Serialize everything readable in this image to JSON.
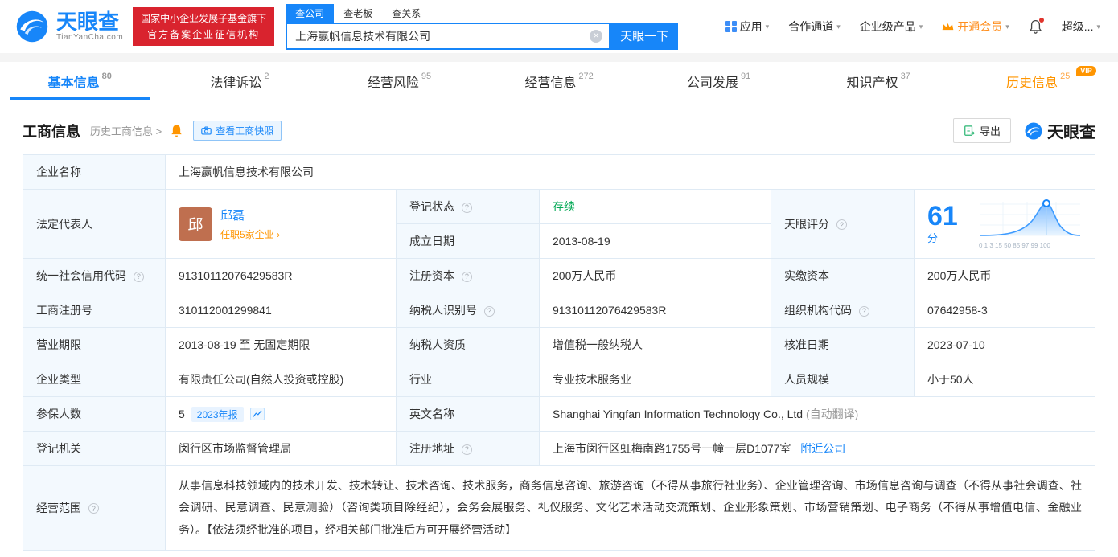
{
  "colors": {
    "accent": "#1786f9",
    "orange": "#ff9500",
    "green": "#00a854",
    "red": "#d9232e"
  },
  "icons": {
    "caret": "▾",
    "clear": "×",
    "chevron_right": ">",
    "chevron_small": "›",
    "help": "?"
  },
  "header": {
    "logo": {
      "name": "天眼查",
      "domain": "TianYanCha.com"
    },
    "cert": {
      "line1": "国家中小企业发展子基金旗下",
      "line2": "官方备案企业征信机构"
    },
    "search_tabs": [
      {
        "label": "查公司"
      },
      {
        "label": "查老板"
      },
      {
        "label": "查关系"
      }
    ],
    "search": {
      "value": "上海赢帆信息技术有限公司",
      "button": "天眼一下"
    },
    "nav": [
      "应用",
      "合作通道",
      "企业级产品",
      "开通会员",
      "超级..."
    ]
  },
  "tabs": [
    {
      "label": "基本信息",
      "count": "80"
    },
    {
      "label": "法律诉讼",
      "count": "2"
    },
    {
      "label": "经营风险",
      "count": "95"
    },
    {
      "label": "经营信息",
      "count": "272"
    },
    {
      "label": "公司发展",
      "count": "91"
    },
    {
      "label": "知识产权",
      "count": "37"
    },
    {
      "label": "历史信息",
      "count": "25",
      "badge": "VIP"
    }
  ],
  "section": {
    "title": "工商信息",
    "history_link": "历史工商信息",
    "snapshot_button": "查看工商快照",
    "export_button": "导出",
    "brand": "天眼查"
  },
  "info": {
    "company_name_label": "企业名称",
    "company_name": "上海赢帆信息技术有限公司",
    "legal_rep_label": "法定代表人",
    "legal_rep_avatar": "邱",
    "legal_rep_name": "邱磊",
    "legal_rep_note": "任职5家企业",
    "reg_status_label": "登记状态",
    "reg_status": "存续",
    "est_date_label": "成立日期",
    "est_date": "2013-08-19",
    "score_label": "天眼评分",
    "score_value": "61",
    "score_unit": "分",
    "score_axis": "0 1 3 15 50 85 97 99 100",
    "credit_code_label": "统一社会信用代码",
    "credit_code": "91310112076429583R",
    "reg_capital_label": "注册资本",
    "reg_capital": "200万人民币",
    "paid_capital_label": "实缴资本",
    "paid_capital": "200万人民币",
    "reg_no_label": "工商注册号",
    "reg_no": "310112001299841",
    "taxpayer_id_label": "纳税人识别号",
    "taxpayer_id": "91310112076429583R",
    "org_code_label": "组织机构代码",
    "org_code": "07642958-3",
    "term_label": "营业期限",
    "term": "2013-08-19 至 无固定期限",
    "taxpayer_quality_label": "纳税人资质",
    "taxpayer_quality": "增值税一般纳税人",
    "approval_date_label": "核准日期",
    "approval_date": "2023-07-10",
    "company_type_label": "企业类型",
    "company_type": "有限责任公司(自然人投资或控股)",
    "industry_label": "行业",
    "industry": "专业技术服务业",
    "staff_label": "人员规模",
    "staff": "小于50人",
    "insured_label": "参保人数",
    "insured": "5",
    "insured_tag": "2023年报",
    "en_name_label": "英文名称",
    "en_name": "Shanghai Yingfan Information Technology Co., Ltd",
    "en_name_note": "(自动翻译)",
    "authority_label": "登记机关",
    "authority": "闵行区市场监督管理局",
    "address_label": "注册地址",
    "address": "上海市闵行区虹梅南路1755号一幢一层D1077室",
    "address_link": "附近公司",
    "scope_label": "经营范围",
    "scope": "从事信息科技领域内的技术开发、技术转让、技术咨询、技术服务，商务信息咨询、旅游咨询（不得从事旅行社业务）、企业管理咨询、市场信息咨询与调查（不得从事社会调查、社会调研、民意调查、民意测验）（咨询类项目除经纪），会务会展服务、礼仪服务、文化艺术活动交流策划、企业形象策划、市场营销策划、电子商务（不得从事增值电信、金融业务）。【依法须经批准的项目，经相关部门批准后方可开展经营活动】"
  }
}
